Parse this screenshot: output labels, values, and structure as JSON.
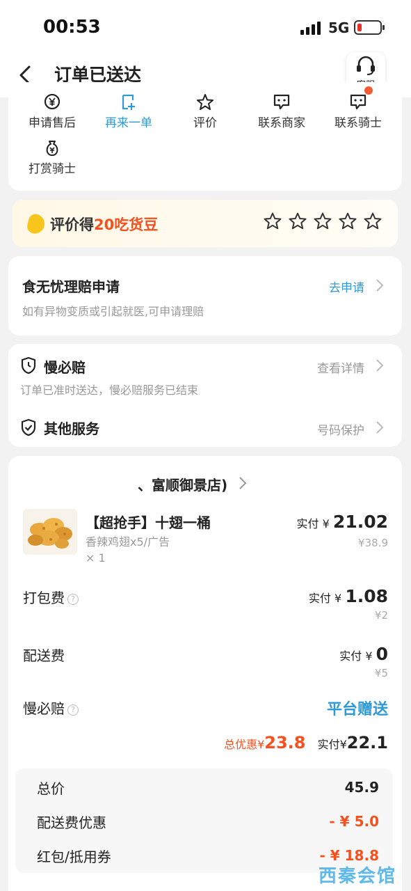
{
  "status_bar": {
    "time": "00:53",
    "network": "5G"
  },
  "nav": {
    "title": "订单已送达",
    "service_label": "客服"
  },
  "actions": [
    {
      "label": "申请售后",
      "icon": "yen-circle-icon"
    },
    {
      "label": "再来一单",
      "icon": "reorder-icon"
    },
    {
      "label": "评价",
      "icon": "star-outline-icon"
    },
    {
      "label": "联系商家",
      "icon": "chat-icon"
    },
    {
      "label": "联系骑士",
      "icon": "chat-icon"
    },
    {
      "label": "打赏骑士",
      "icon": "money-bag-icon"
    }
  ],
  "rating": {
    "prefix": "评价得",
    "reward": "20吃货豆",
    "stars": 5
  },
  "claim": {
    "title": "食无忧理赔申请",
    "link": "去申请",
    "desc": "如有异物变质或引起就医,可申请理赔"
  },
  "late_comp": {
    "title": "慢必赔",
    "link": "查看详情",
    "desc": "订单已准时送达，慢必赔服务已结束"
  },
  "other_service": {
    "title": "其他服务",
    "link": "号码保护"
  },
  "shop": {
    "name": "、富顺御景店)"
  },
  "item": {
    "name": "【超抢手】十翅一桶",
    "spec": "香辣鸡翅x5/广告",
    "qty": "× 1",
    "paid_label": "实付",
    "currency": "¥",
    "paid": "21.02",
    "original": "¥38.9"
  },
  "fees": [
    {
      "label": "打包费",
      "paid_label": "实付",
      "currency": "¥",
      "paid": "1.08",
      "original": "¥2"
    },
    {
      "label": "配送费",
      "paid_label": "实付",
      "currency": "¥",
      "paid": "0",
      "original": "¥5"
    },
    {
      "label": "慢必赔",
      "value": "平台赠送"
    }
  ],
  "totals": {
    "discount_label": "总优惠",
    "currency": "¥",
    "discount": "23.8",
    "paid_label": "实付",
    "paid": "22.1"
  },
  "summary": [
    {
      "label": "总价",
      "value": "45.9"
    },
    {
      "label": "配送费优惠",
      "value": "- ¥ 5.0"
    },
    {
      "label": "红包/抵用券",
      "value": "- ¥ 18.8"
    }
  ],
  "watermark": "西秦会馆",
  "colors": {
    "accent_blue": "#2f9ad8",
    "discount_red": "#f4511e",
    "bean_yellow": "#f7c51b"
  }
}
